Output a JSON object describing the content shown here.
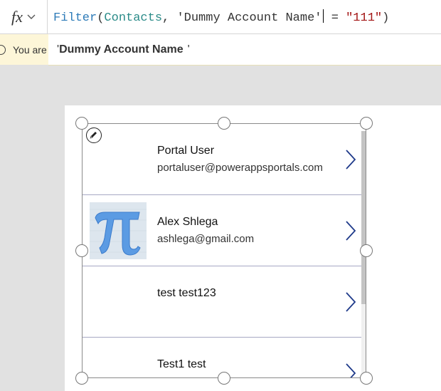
{
  "formula_bar": {
    "fx_label": "fx",
    "formula_fn": "Filter",
    "formula_paren_open": "(",
    "formula_source": "Contacts",
    "formula_sep": ", ",
    "formula_field": "'Dummy Account Name'",
    "formula_op": " = ",
    "formula_value": "\"111\"",
    "formula_paren_close": ")"
  },
  "warning": {
    "text": "You are"
  },
  "suggestion": {
    "quote_open": "'",
    "bold_text": "Dummy Account Name",
    "quote_close": "'"
  },
  "gallery": {
    "items": [
      {
        "title": "Portal User",
        "subtitle": "portaluser@powerappsportals.com",
        "has_image": false
      },
      {
        "title": "Alex Shlega",
        "subtitle": "ashlega@gmail.com",
        "has_image": true
      },
      {
        "title": "test test123",
        "subtitle": "",
        "has_image": false
      },
      {
        "title": "Test1 test",
        "subtitle": "",
        "has_image": false
      }
    ]
  },
  "icons": {
    "fx": "function-icon",
    "dropdown": "chevron-down-icon",
    "warning": "info-circle-icon",
    "edit": "pencil-icon",
    "row_nav": "chevron-right-icon"
  },
  "colors": {
    "function": "#2d7bb8",
    "identifier": "#2a8b88",
    "string": "#a31515",
    "warning_bg": "#fdf6d8",
    "row_divider": "#a7a8c4",
    "chevron": "#1f3a8a"
  }
}
